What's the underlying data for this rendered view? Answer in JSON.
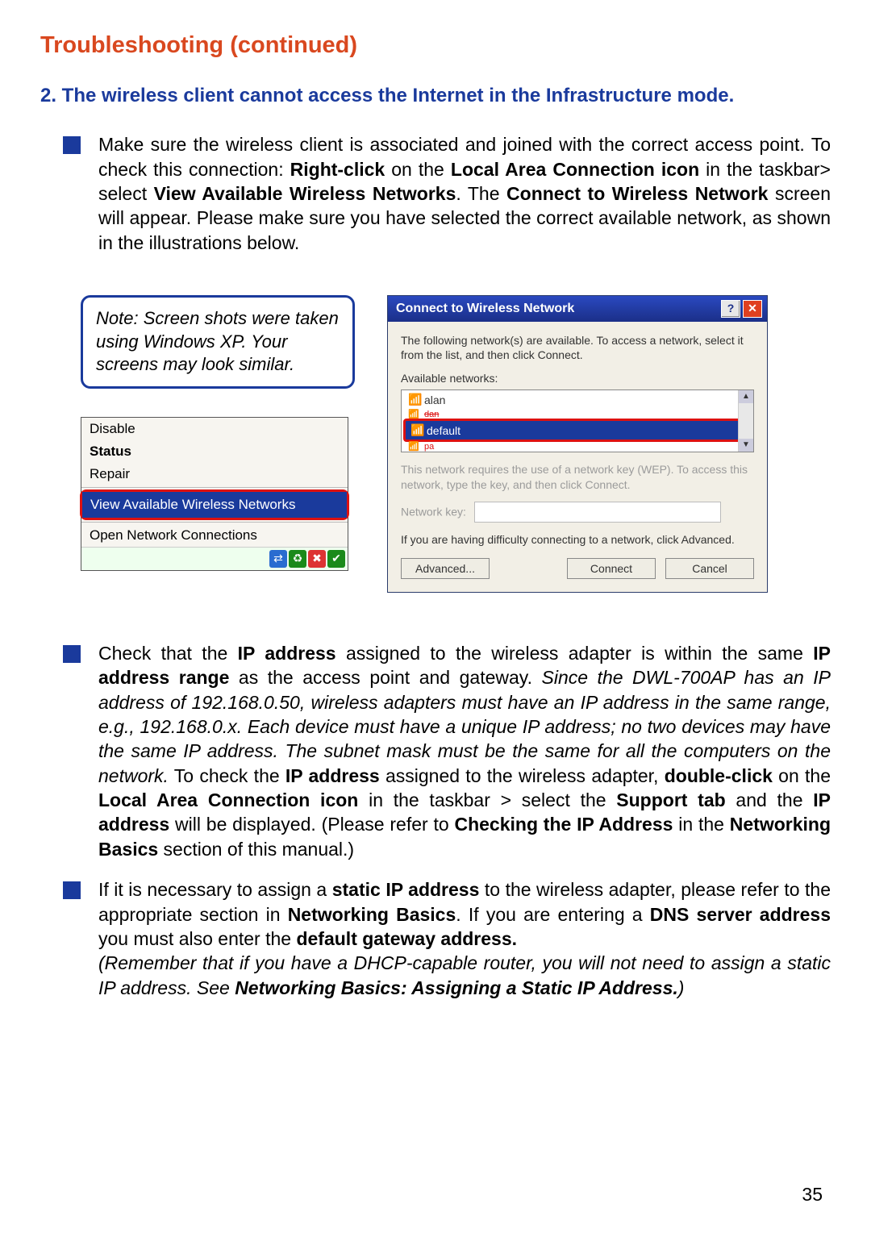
{
  "page_number": "35",
  "heading": "Troubleshooting (continued)",
  "subheading": "2. The wireless client cannot access the Internet in the Infrastructure mode.",
  "bullets": {
    "b1": {
      "pre": "Make sure the wireless client is associated and joined with the correct access point. To check this connection: ",
      "bold1": "Right-click",
      "mid1": " on the ",
      "bold2": "Local Area Connection icon",
      "mid2": " in the taskbar> select ",
      "bold3": "View Available Wireless Networks",
      "mid3": ". The ",
      "bold4": "Connect to Wireless Network",
      "tail": " screen will appear. Please make sure you have selected the correct available network, as shown in the illustrations below."
    },
    "b2": {
      "pre": "Check that the ",
      "bold1": "IP address",
      "mid1": " assigned to the wireless adapter is within the same ",
      "bold2": "IP address range",
      "mid2": " as the access point and gateway. ",
      "italic1": "Since the DWL-700AP has an IP address of 192.168.0.50, wireless adapters must have an IP address in the same range, e.g., 192.168.0.x. Each device must have a unique IP address; no two devices may have the same IP address. The subnet mask must be the same for all the computers on the network.",
      "mid3": " To check the ",
      "bold3": "IP address",
      "mid4": " assigned to the wireless adapter, ",
      "bold4": "double-click",
      "mid5": " on the ",
      "bold5": "Local Area Connection icon",
      "mid6": " in the taskbar > select the ",
      "bold6": "Support tab",
      "mid7": " and the ",
      "bold7": "IP address",
      "mid8": " will be displayed. (Please refer to ",
      "bold8": "Checking the IP Address",
      "mid9": " in the ",
      "bold9": "Networking Basics",
      "tail": " section of this manual.)"
    },
    "b3": {
      "pre": "If it is necessary to assign a ",
      "bold1": "static IP address",
      "mid1": " to the wireless adapter, please refer to the appropriate section in ",
      "bold2": "Networking Basics",
      "mid2": ". If you are entering a ",
      "bold3": "DNS server address",
      "mid3": " you must also enter the ",
      "bold4": "default gateway address.",
      "br": " ",
      "italic_pre": "(Remember that if you have a DHCP-capable router, you will not need to assign a static IP address. See  ",
      "italic_bold": "Networking Basics: Assigning a Static IP Address.",
      "italic_tail": ")"
    }
  },
  "note": "Note: Screen shots were taken using Windows XP. Your screens may look similar.",
  "context_menu": {
    "items": [
      "Disable",
      "Status",
      "Repair"
    ],
    "highlight": "View Available Wireless Networks",
    "after": "Open Network Connections"
  },
  "dialog": {
    "title": "Connect to Wireless Network",
    "intro": "The following network(s) are available. To access a network, select it from the list, and then click Connect.",
    "list_label": "Available networks:",
    "networks": {
      "n0": "alan",
      "dan": "dan",
      "n1": "default",
      "pa": "pa"
    },
    "wep_text": "This network requires the use of a network key (WEP). To access this network, type the key, and then click Connect.",
    "key_label": "Network key:",
    "adv_text": "If you are having difficulty connecting to a network, click Advanced.",
    "buttons": {
      "advanced": "Advanced...",
      "connect": "Connect",
      "cancel": "Cancel"
    }
  }
}
